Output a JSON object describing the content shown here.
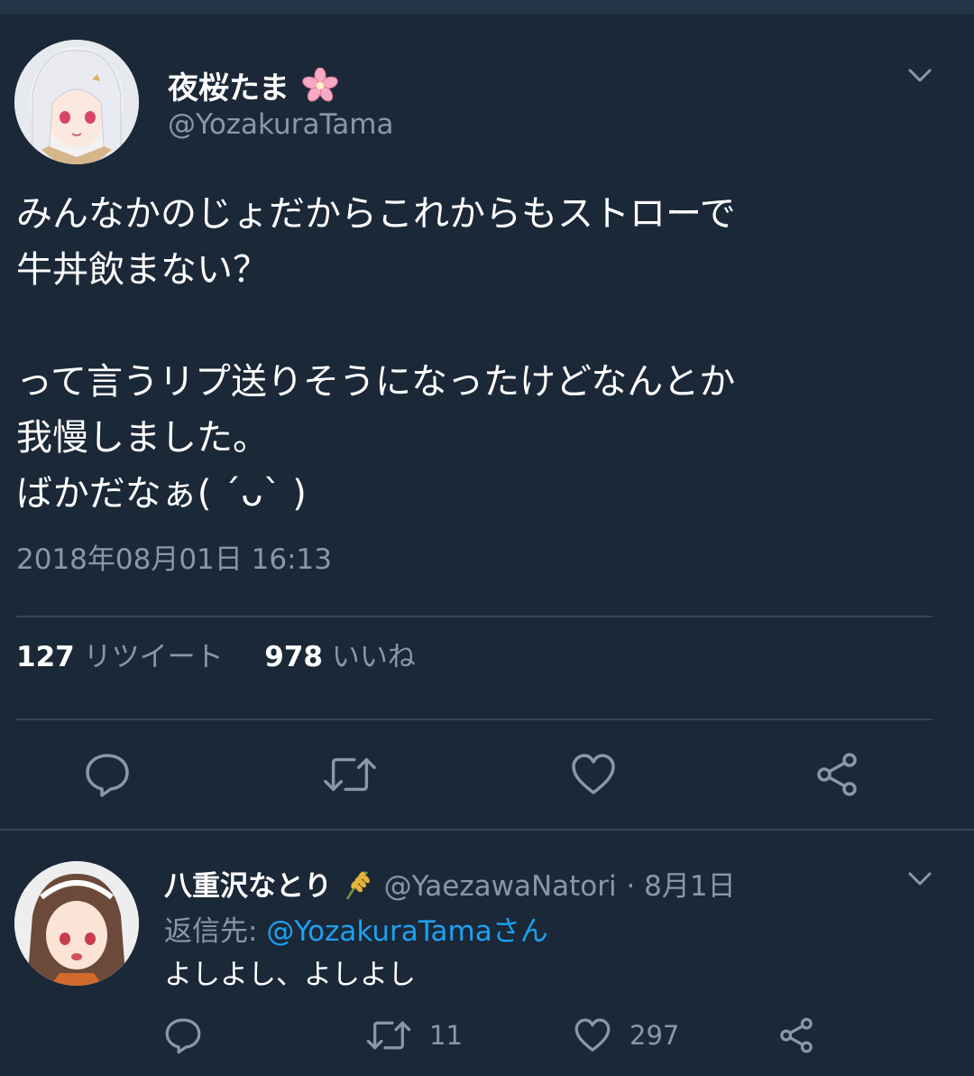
{
  "main_tweet": {
    "display_name": "夜桜たま",
    "name_emoji": "🌸",
    "handle": "@YozakuraTama",
    "lines": [
      "みんなかのじょだからこれからもストローで",
      "牛丼飲まない？",
      "",
      "って言うリプ送りそうになったけどなんとか",
      "我慢しました。",
      "ばかだなぁ( ´ᴗ` )"
    ],
    "timestamp": "2018年08月01日 16:13",
    "retweets": "127",
    "retweets_label": "リツイート",
    "likes": "978",
    "likes_label": "いいね"
  },
  "reply": {
    "display_name": "八重沢なとり",
    "handle": "@YaezawaNatori",
    "date": "· 8月1日",
    "reply_to_label": "返信先:",
    "reply_to_handle": "@YozakuraTamaさん",
    "text": "よしよし、よしよし",
    "retweets": "11",
    "likes": "297"
  },
  "icons": {
    "reply": "reply-icon",
    "retweet": "retweet-icon",
    "like": "heart-icon",
    "share": "share-icon",
    "menu": "chevron-down-icon"
  },
  "colors": {
    "background": "#1b2838",
    "secondary_text": "#8899a6",
    "link": "#1da1f2",
    "divider": "#38444d"
  }
}
